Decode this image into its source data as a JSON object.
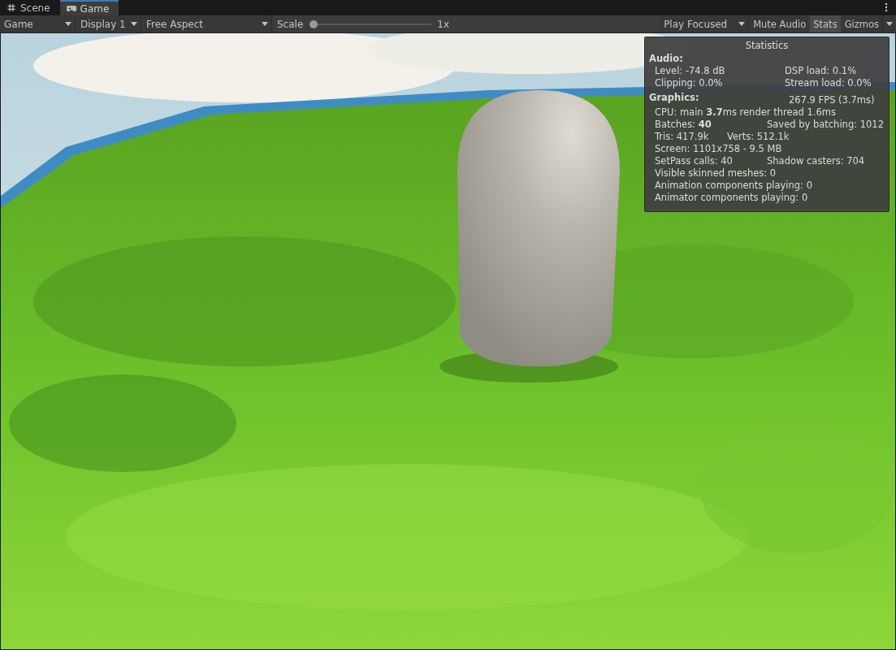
{
  "tabs": [
    {
      "label": "Scene",
      "kind": "grid",
      "selected": false
    },
    {
      "label": "Game",
      "kind": "gamepad",
      "selected": true
    }
  ],
  "toolbar": {
    "left": [
      {
        "kind": "dropdown",
        "label": "Game"
      },
      {
        "kind": "dropdown",
        "label": "Display 1"
      },
      {
        "kind": "dropdown",
        "label": "Free Aspect"
      },
      {
        "kind": "slider",
        "label": "Scale",
        "level": 0,
        "reading": "1x"
      }
    ],
    "right": [
      {
        "kind": "dropdown",
        "label": "Play Focused"
      },
      {
        "kind": "toggle",
        "label": "Mute Audio",
        "on": false
      },
      {
        "kind": "toggle",
        "label": "Stats",
        "on": true
      },
      {
        "kind": "split",
        "label": "Gizmos"
      }
    ]
  },
  "statistics": {
    "title": "Statistics",
    "sections": [
      {
        "heading": "Audio:",
        "lines": [
          [
            "Level: -74.8 dB",
            "DSP load: 0.1%"
          ],
          [
            "Clipping: 0.0%",
            "Stream load: 0.0%"
          ]
        ]
      },
      {
        "heading": "Graphics:",
        "aside": "267.9 FPS (3.7ms)",
        "lines": [
          [
            "CPU: main **3.7**ms  render thread 1.6ms"
          ],
          [
            "Batches: **40**",
            "Saved by batching: 1012"
          ],
          [
            "Tris: 417.9k",
            "Verts: 512.1k"
          ],
          [
            "Screen: 1101x758 - 9.5 MB"
          ],
          [
            "SetPass calls: 40",
            "Shadow casters: 704"
          ],
          [
            "Visible skinned meshes: 0"
          ],
          [
            "Animation components playing: 0"
          ],
          [
            "Animator components playing: 0"
          ]
        ]
      }
    ]
  }
}
